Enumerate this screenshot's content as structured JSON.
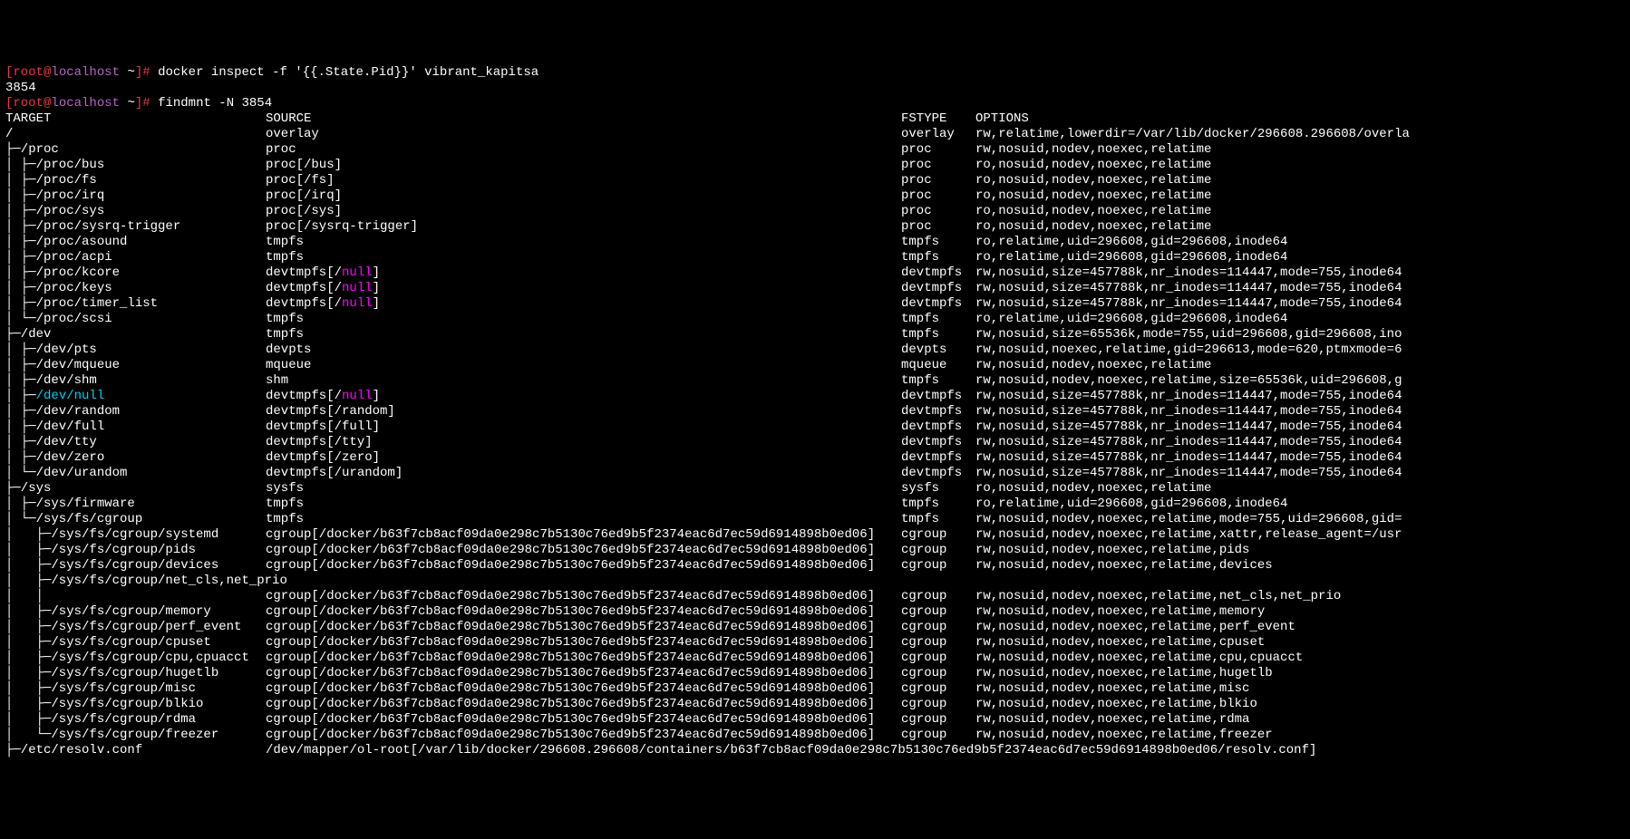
{
  "prompt": {
    "lbracket": "[",
    "user": "root",
    "at": "@",
    "host": "localhost",
    "dir": " ~",
    "rbracket": "]",
    "hash": "# "
  },
  "cmd1": "docker inspect -f '{{.State.Pid}}' vibrant_kapitsa",
  "pid_output": "3854",
  "cmd2": "findmnt -N 3854",
  "header": {
    "target": "TARGET",
    "source": "SOURCE",
    "fstype": "FSTYPE",
    "options": "OPTIONS"
  },
  "rows": [
    {
      "t": "/",
      "s": "overlay",
      "f": "overlay",
      "o": "rw,relatime,lowerdir=/var/lib/docker/296608.296608/overla"
    },
    {
      "t": "├─/proc",
      "s": "proc",
      "f": "proc",
      "o": "rw,nosuid,nodev,noexec,relatime"
    },
    {
      "t": "│ ├─/proc/bus",
      "s": "proc[/bus]",
      "f": "proc",
      "o": "ro,nosuid,nodev,noexec,relatime"
    },
    {
      "t": "│ ├─/proc/fs",
      "s": "proc[/fs]",
      "f": "proc",
      "o": "ro,nosuid,nodev,noexec,relatime"
    },
    {
      "t": "│ ├─/proc/irq",
      "s": "proc[/irq]",
      "f": "proc",
      "o": "ro,nosuid,nodev,noexec,relatime"
    },
    {
      "t": "│ ├─/proc/sys",
      "s": "proc[/sys]",
      "f": "proc",
      "o": "ro,nosuid,nodev,noexec,relatime"
    },
    {
      "t": "│ ├─/proc/sysrq-trigger",
      "s": "proc[/sysrq-trigger]",
      "f": "proc",
      "o": "ro,nosuid,nodev,noexec,relatime"
    },
    {
      "t": "│ ├─/proc/asound",
      "s": "tmpfs",
      "f": "tmpfs",
      "o": "ro,relatime,uid=296608,gid=296608,inode64"
    },
    {
      "t": "│ ├─/proc/acpi",
      "s": "tmpfs",
      "f": "tmpfs",
      "o": "ro,relatime,uid=296608,gid=296608,inode64"
    },
    {
      "t": "│ ├─/proc/kcore",
      "s": "devtmpfs[/null]",
      "m": 1,
      "f": "devtmpfs",
      "o": "rw,nosuid,size=457788k,nr_inodes=114447,mode=755,inode64"
    },
    {
      "t": "│ ├─/proc/keys",
      "s": "devtmpfs[/null]",
      "m": 1,
      "f": "devtmpfs",
      "o": "rw,nosuid,size=457788k,nr_inodes=114447,mode=755,inode64"
    },
    {
      "t": "│ ├─/proc/timer_list",
      "s": "devtmpfs[/null]",
      "m": 1,
      "f": "devtmpfs",
      "o": "rw,nosuid,size=457788k,nr_inodes=114447,mode=755,inode64"
    },
    {
      "t": "│ └─/proc/scsi",
      "s": "tmpfs",
      "f": "tmpfs",
      "o": "ro,relatime,uid=296608,gid=296608,inode64"
    },
    {
      "t": "├─/dev",
      "s": "tmpfs",
      "f": "tmpfs",
      "o": "rw,nosuid,size=65536k,mode=755,uid=296608,gid=296608,ino"
    },
    {
      "t": "│ ├─/dev/pts",
      "s": "devpts",
      "f": "devpts",
      "o": "rw,nosuid,noexec,relatime,gid=296613,mode=620,ptmxmode=6"
    },
    {
      "t": "│ ├─/dev/mqueue",
      "s": "mqueue",
      "f": "mqueue",
      "o": "rw,nosuid,nodev,noexec,relatime"
    },
    {
      "t": "│ ├─/dev/shm",
      "s": "shm",
      "f": "tmpfs",
      "o": "rw,nosuid,nodev,noexec,relatime,size=65536k,uid=296608,g"
    },
    {
      "t": "│ ├─/dev/null",
      "cyan": 1,
      "s": "devtmpfs[/null]",
      "m": 1,
      "f": "devtmpfs",
      "o": "rw,nosuid,size=457788k,nr_inodes=114447,mode=755,inode64"
    },
    {
      "t": "│ ├─/dev/random",
      "s": "devtmpfs[/random]",
      "f": "devtmpfs",
      "o": "rw,nosuid,size=457788k,nr_inodes=114447,mode=755,inode64"
    },
    {
      "t": "│ ├─/dev/full",
      "s": "devtmpfs[/full]",
      "f": "devtmpfs",
      "o": "rw,nosuid,size=457788k,nr_inodes=114447,mode=755,inode64"
    },
    {
      "t": "│ ├─/dev/tty",
      "s": "devtmpfs[/tty]",
      "f": "devtmpfs",
      "o": "rw,nosuid,size=457788k,nr_inodes=114447,mode=755,inode64"
    },
    {
      "t": "│ ├─/dev/zero",
      "s": "devtmpfs[/zero]",
      "f": "devtmpfs",
      "o": "rw,nosuid,size=457788k,nr_inodes=114447,mode=755,inode64"
    },
    {
      "t": "│ └─/dev/urandom",
      "s": "devtmpfs[/urandom]",
      "f": "devtmpfs",
      "o": "rw,nosuid,size=457788k,nr_inodes=114447,mode=755,inode64"
    },
    {
      "t": "├─/sys",
      "s": "sysfs",
      "f": "sysfs",
      "o": "ro,nosuid,nodev,noexec,relatime"
    },
    {
      "t": "│ ├─/sys/firmware",
      "s": "tmpfs",
      "f": "tmpfs",
      "o": "ro,relatime,uid=296608,gid=296608,inode64"
    },
    {
      "t": "│ └─/sys/fs/cgroup",
      "s": "tmpfs",
      "f": "tmpfs",
      "o": "rw,nosuid,nodev,noexec,relatime,mode=755,uid=296608,gid="
    },
    {
      "t": "│   ├─/sys/fs/cgroup/systemd",
      "s": "cgroup[/docker/b63f7cb8acf09da0e298c7b5130c76ed9b5f2374eac6d7ec59d6914898b0ed06]",
      "f": "cgroup",
      "o": "rw,nosuid,nodev,noexec,relatime,xattr,release_agent=/usr"
    },
    {
      "t": "│   ├─/sys/fs/cgroup/pids",
      "s": "cgroup[/docker/b63f7cb8acf09da0e298c7b5130c76ed9b5f2374eac6d7ec59d6914898b0ed06]",
      "f": "cgroup",
      "o": "rw,nosuid,nodev,noexec,relatime,pids"
    },
    {
      "t": "│   ├─/sys/fs/cgroup/devices",
      "s": "cgroup[/docker/b63f7cb8acf09da0e298c7b5130c76ed9b5f2374eac6d7ec59d6914898b0ed06]",
      "f": "cgroup",
      "o": "rw,nosuid,nodev,noexec,relatime,devices"
    },
    {
      "t": "│   ├─/sys/fs/cgroup/net_cls,net_prio",
      "s": "",
      "f": "",
      "o": ""
    },
    {
      "t": "│   │",
      "s": "cgroup[/docker/b63f7cb8acf09da0e298c7b5130c76ed9b5f2374eac6d7ec59d6914898b0ed06]",
      "f": "cgroup",
      "o": "rw,nosuid,nodev,noexec,relatime,net_cls,net_prio"
    },
    {
      "t": "│   ├─/sys/fs/cgroup/memory",
      "s": "cgroup[/docker/b63f7cb8acf09da0e298c7b5130c76ed9b5f2374eac6d7ec59d6914898b0ed06]",
      "f": "cgroup",
      "o": "rw,nosuid,nodev,noexec,relatime,memory"
    },
    {
      "t": "│   ├─/sys/fs/cgroup/perf_event",
      "s": "cgroup[/docker/b63f7cb8acf09da0e298c7b5130c76ed9b5f2374eac6d7ec59d6914898b0ed06]",
      "f": "cgroup",
      "o": "rw,nosuid,nodev,noexec,relatime,perf_event"
    },
    {
      "t": "│   ├─/sys/fs/cgroup/cpuset",
      "s": "cgroup[/docker/b63f7cb8acf09da0e298c7b5130c76ed9b5f2374eac6d7ec59d6914898b0ed06]",
      "f": "cgroup",
      "o": "rw,nosuid,nodev,noexec,relatime,cpuset"
    },
    {
      "t": "│   ├─/sys/fs/cgroup/cpu,cpuacct",
      "s": "cgroup[/docker/b63f7cb8acf09da0e298c7b5130c76ed9b5f2374eac6d7ec59d6914898b0ed06]",
      "f": "cgroup",
      "o": "rw,nosuid,nodev,noexec,relatime,cpu,cpuacct"
    },
    {
      "t": "│   ├─/sys/fs/cgroup/hugetlb",
      "s": "cgroup[/docker/b63f7cb8acf09da0e298c7b5130c76ed9b5f2374eac6d7ec59d6914898b0ed06]",
      "f": "cgroup",
      "o": "rw,nosuid,nodev,noexec,relatime,hugetlb"
    },
    {
      "t": "│   ├─/sys/fs/cgroup/misc",
      "s": "cgroup[/docker/b63f7cb8acf09da0e298c7b5130c76ed9b5f2374eac6d7ec59d6914898b0ed06]",
      "f": "cgroup",
      "o": "rw,nosuid,nodev,noexec,relatime,misc"
    },
    {
      "t": "│   ├─/sys/fs/cgroup/blkio",
      "s": "cgroup[/docker/b63f7cb8acf09da0e298c7b5130c76ed9b5f2374eac6d7ec59d6914898b0ed06]",
      "f": "cgroup",
      "o": "rw,nosuid,nodev,noexec,relatime,blkio"
    },
    {
      "t": "│   ├─/sys/fs/cgroup/rdma",
      "s": "cgroup[/docker/b63f7cb8acf09da0e298c7b5130c76ed9b5f2374eac6d7ec59d6914898b0ed06]",
      "f": "cgroup",
      "o": "rw,nosuid,nodev,noexec,relatime,rdma"
    },
    {
      "t": "│   └─/sys/fs/cgroup/freezer",
      "s": "cgroup[/docker/b63f7cb8acf09da0e298c7b5130c76ed9b5f2374eac6d7ec59d6914898b0ed06]",
      "f": "cgroup",
      "o": "rw,nosuid,nodev,noexec,relatime,freezer"
    },
    {
      "t": "├─/etc/resolv.conf",
      "s": "/dev/mapper/ol-root[/var/lib/docker/296608.296608/containers/b63f7cb8acf09da0e298c7b5130c76ed9b5f2374eac6d7ec59d6914898b0ed06/resolv.conf]",
      "f": "",
      "o": ""
    }
  ]
}
